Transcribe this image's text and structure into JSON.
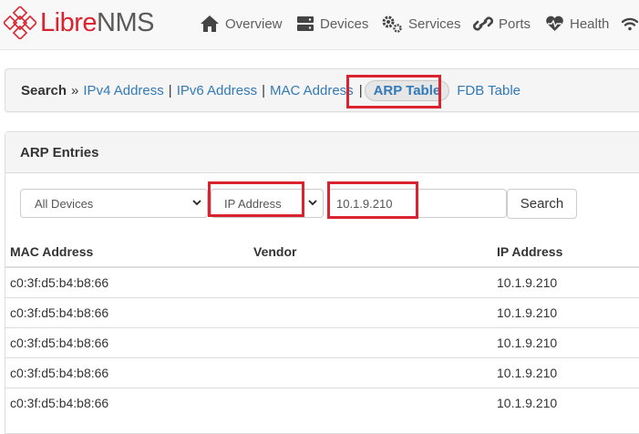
{
  "brand": {
    "part1": "Libre",
    "part2": "NMS",
    "color_red": "#d9232e",
    "color_gray": "#5a5a5a"
  },
  "nav": {
    "overview": {
      "label": "Overview",
      "icon": "home-icon"
    },
    "devices": {
      "label": "Devices",
      "icon": "server-icon"
    },
    "services": {
      "label": "Services",
      "icon": "cogs-icon"
    },
    "ports": {
      "label": "Ports",
      "icon": "link-icon"
    },
    "health": {
      "label": "Health",
      "icon": "heartbeat-icon"
    },
    "wireless": {
      "icon": "wifi-icon"
    }
  },
  "breadcrumb": {
    "title": "Search",
    "separator": "»",
    "pipe": "|",
    "ipv4": "IPv4 Address",
    "ipv6": "IPv6 Address",
    "mac": "MAC Address",
    "arp": "ARP Table",
    "fdb": "FDB Table"
  },
  "panel": {
    "title": "ARP Entries"
  },
  "filters": {
    "device": "All Devices",
    "search_by": "IP Address",
    "query": "10.1.9.210",
    "search_button": "Search"
  },
  "table": {
    "headers": {
      "mac": "MAC Address",
      "vendor": "Vendor",
      "ip": "IP Address"
    },
    "rows": [
      {
        "mac": "c0:3f:d5:b4:b8:66",
        "vendor": "",
        "ip": "10.1.9.210"
      },
      {
        "mac": "c0:3f:d5:b4:b8:66",
        "vendor": "",
        "ip": "10.1.9.210"
      },
      {
        "mac": "c0:3f:d5:b4:b8:66",
        "vendor": "",
        "ip": "10.1.9.210"
      },
      {
        "mac": "c0:3f:d5:b4:b8:66",
        "vendor": "",
        "ip": "10.1.9.210"
      },
      {
        "mac": "c0:3f:d5:b4:b8:66",
        "vendor": "",
        "ip": "10.1.9.210"
      }
    ]
  },
  "colors": {
    "link": "#337ab7",
    "highlight": "#d9232e"
  }
}
